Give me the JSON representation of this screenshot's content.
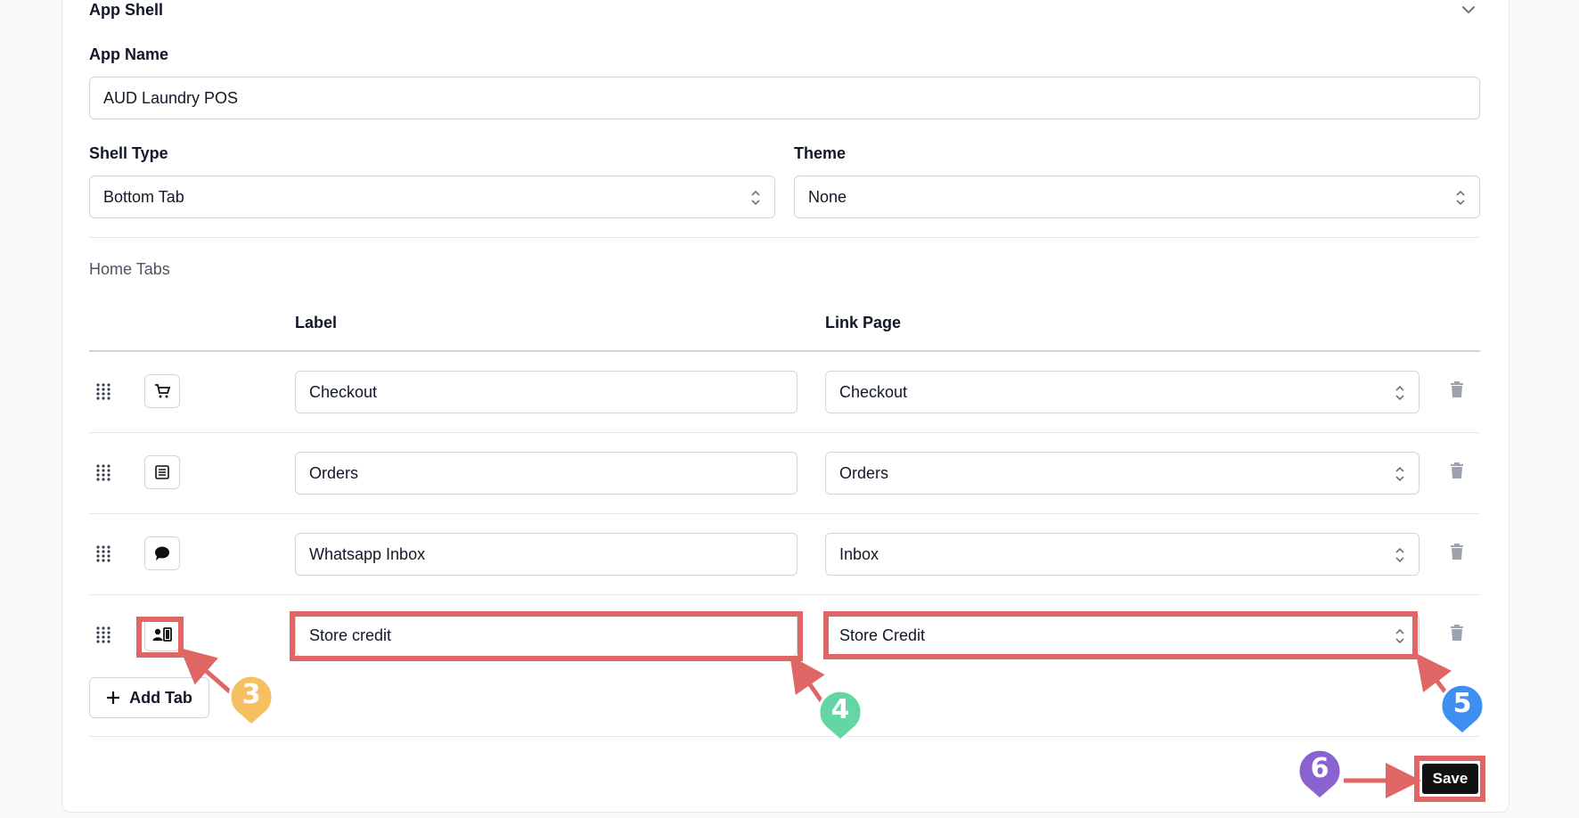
{
  "section": {
    "title": "App Shell"
  },
  "app_name": {
    "label": "App Name",
    "value": "AUD Laundry POS"
  },
  "shell_type": {
    "label": "Shell Type",
    "value": "Bottom Tab"
  },
  "theme": {
    "label": "Theme",
    "value": "None"
  },
  "home_tabs": {
    "title": "Home Tabs",
    "columns": {
      "label": "Label",
      "link_page": "Link Page"
    },
    "rows": [
      {
        "icon": "cart-icon",
        "label": "Checkout",
        "link_page": "Checkout"
      },
      {
        "icon": "list-icon",
        "label": "Orders",
        "link_page": "Orders"
      },
      {
        "icon": "chat-icon",
        "label": "Whatsapp Inbox",
        "link_page": "Inbox"
      },
      {
        "icon": "contact-card-icon",
        "label": "Store credit",
        "link_page": "Store Credit"
      }
    ],
    "add_tab_label": "Add Tab"
  },
  "save_label": "Save",
  "annotations": {
    "markers": [
      "3",
      "4",
      "5",
      "6"
    ],
    "colors": {
      "highlight": "#e06666",
      "m3": "#f6c061",
      "m4": "#62d6a5",
      "m5": "#3f8ff0",
      "m6": "#8b63d1"
    }
  }
}
